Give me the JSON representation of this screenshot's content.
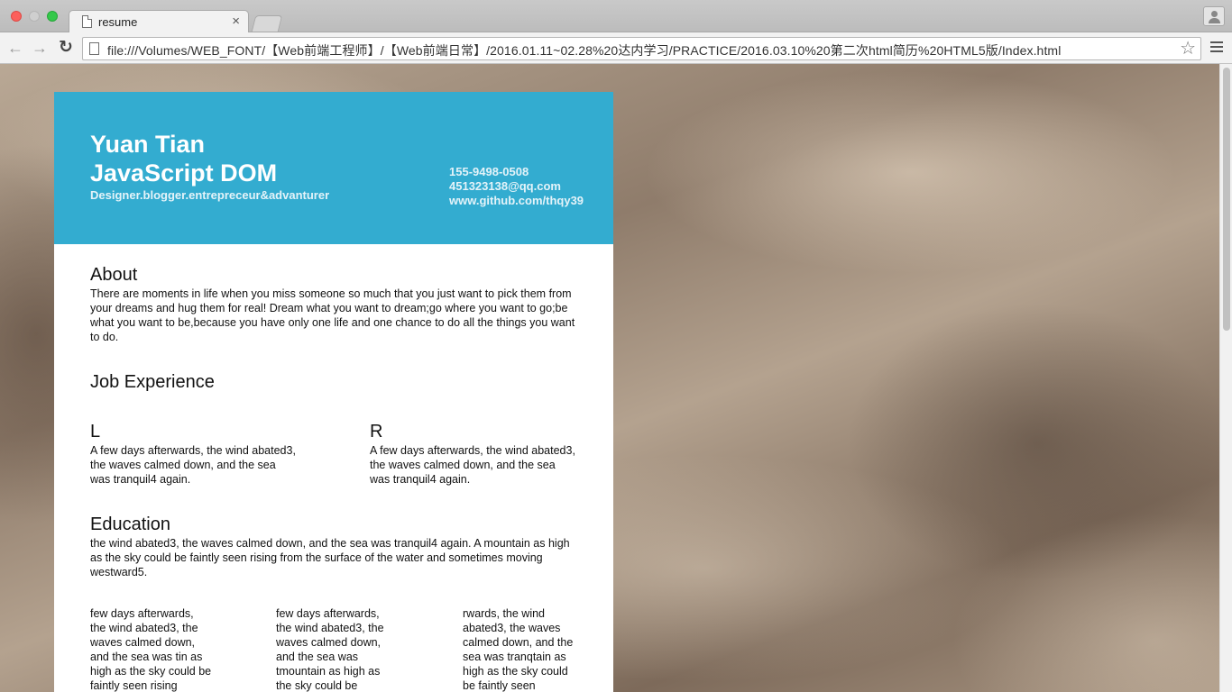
{
  "browser": {
    "tab_title": "resume",
    "tab_close": "×",
    "url": "file:///Volumes/WEB_FONT/【Web前端工程师】/【Web前端日常】/2016.01.11~02.28%20达内学习/PRACTICE/2016.03.10%20第二次html简历%20HTML5版/Index.html",
    "back": "←",
    "forward": "→",
    "reload": "↻",
    "star": "☆"
  },
  "header": {
    "name": "Yuan Tian",
    "role": "JavaScript DOM",
    "tagline": "Designer.blogger.entrepreceur&advanturer",
    "phone": "155-9498-0508",
    "email": "451323138@qq.com",
    "github": "www.github.com/thqy39"
  },
  "about": {
    "title": "About",
    "text": "There are moments in life when you miss someone so much that you just want to pick them from your dreams and hug them for real! Dream what you want to dream;go where you want to go;be what you want to be,because you have only one life and one chance to do all the things you want to do."
  },
  "job": {
    "title": "Job Experience",
    "left_title": "L",
    "left_text": "A few days afterwards, the wind abated3, the waves calmed down, and the sea was tranquil4 again.",
    "right_title": "R",
    "right_text": "A few days afterwards, the wind abated3, the waves calmed down, and the sea was tranquil4 again."
  },
  "education": {
    "title": "Education",
    "text": "the wind abated3, the waves calmed down, and the sea was tranquil4 again. A mountain as high as the sky could be faintly seen rising from the surface of the water and sometimes moving westward5.",
    "col1": "few days afterwards, the wind abated3, the waves calmed down, and the sea was tin as high as the sky could be faintly seen rising",
    "col2": "few days afterwards, the wind abated3, the waves calmed down, and the sea was tmountain as high as the sky could be",
    "col3": "rwards, the wind abated3, the waves calmed down, and the sea was tranqtain as high as the sky could be faintly seen"
  },
  "colors": {
    "header_bg": "#33acd0",
    "card_bg": "#ffffff"
  }
}
